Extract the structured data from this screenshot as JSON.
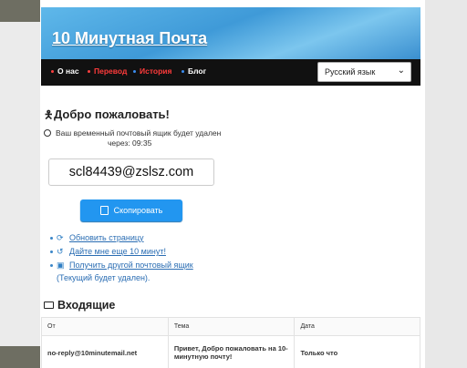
{
  "site": {
    "title": "10 Минутная Почта"
  },
  "nav": {
    "items": [
      {
        "label": "О нас",
        "color": "#ffffff",
        "dot": "#ff4040"
      },
      {
        "label": "Перевод",
        "color": "#ff3b3b",
        "dot": "#ff4040"
      },
      {
        "label": "История",
        "color": "#ff3b3b",
        "dot": "#3b8df0"
      },
      {
        "label": "Блог",
        "color": "#ffffff",
        "dot": "#3b8df0"
      }
    ],
    "language": "Русский язык"
  },
  "welcome": {
    "title": "Добро пожаловать!",
    "note_line1": "Ваш временный почтовый ящик будет удален",
    "note_line2": "через: 09:35"
  },
  "email": {
    "address": "scl84439@zslsz.com"
  },
  "copy_button": {
    "label": "Скопировать"
  },
  "actions": {
    "refresh": "Обновить страницу",
    "more_time": "Дайте мне еще 10 минут!",
    "new_box": "Получить другой почтовый ящик",
    "new_box_note": "(Текущий будет удален)."
  },
  "inbox": {
    "title": "Входящие",
    "columns": [
      "От",
      "Тема",
      "Дата"
    ],
    "rows": [
      {
        "from": "no-reply@10minutemail.net",
        "subject": "Привет, Добро пожаловать на 10-минутную почту!",
        "date": "Только что"
      }
    ]
  },
  "colors": {
    "accent": "#2296f0",
    "link": "#2a6db3",
    "navbar": "#111111"
  }
}
